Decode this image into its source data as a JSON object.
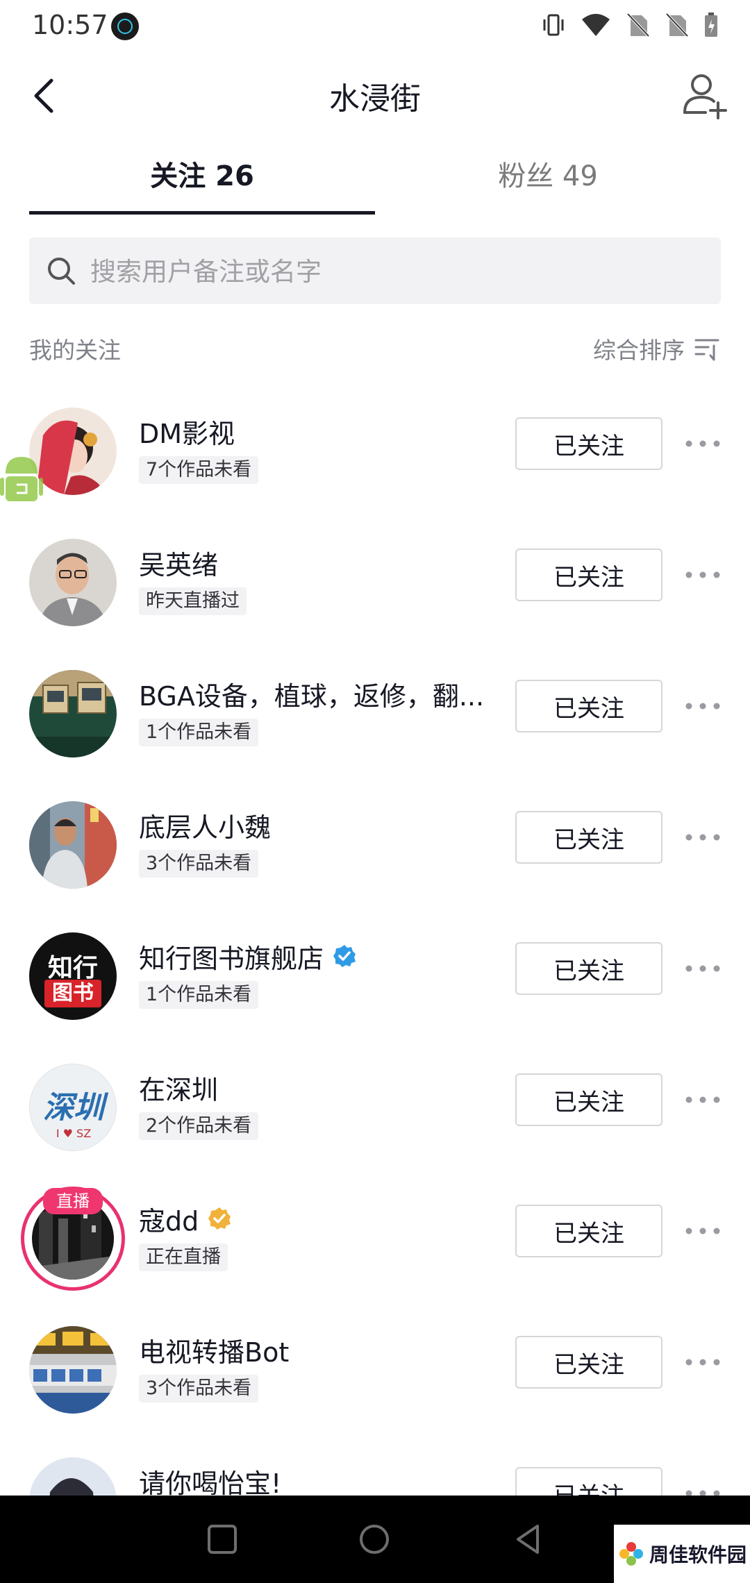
{
  "status_bar": {
    "time": "10:57"
  },
  "header": {
    "title": "水浸街"
  },
  "tabs": [
    {
      "label": "关注 26",
      "active": true
    },
    {
      "label": "粉丝 49",
      "active": false
    }
  ],
  "search": {
    "placeholder": "搜索用户备注或名字"
  },
  "section": {
    "title": "我的关注",
    "sort_label": "综合排序"
  },
  "follows": [
    {
      "name": "DM影视",
      "tag": "7个作品未看",
      "button": "已关注",
      "badge": ""
    },
    {
      "name": "吴英绪",
      "tag": "昨天直播过",
      "button": "已关注",
      "badge": ""
    },
    {
      "name": "BGA设备，植球，返修，翻...",
      "tag": "1个作品未看",
      "button": "已关注",
      "badge": ""
    },
    {
      "name": "底层人小魏",
      "tag": "3个作品未看",
      "button": "已关注",
      "badge": ""
    },
    {
      "name": "知行图书旗舰店",
      "tag": "1个作品未看",
      "button": "已关注",
      "badge": "blue-verified"
    },
    {
      "name": "在深圳",
      "tag": "2个作品未看",
      "button": "已关注",
      "badge": ""
    },
    {
      "name": "寇dd",
      "tag": "正在直播",
      "button": "已关注",
      "badge": "gold-verified",
      "live_label": "直播"
    },
    {
      "name": "电视转播Bot",
      "tag": "3个作品未看",
      "button": "已关注",
      "badge": ""
    },
    {
      "name": "请你喝怡宝!",
      "tag": "",
      "button": "已关注",
      "badge": ""
    }
  ],
  "avatar_text": {
    "zhixing_top": "知行",
    "zhixing_bottom": "图书",
    "shenzhen": "深圳",
    "shenzhen_sub": "I ♥ SZ"
  },
  "watermark": {
    "text": "周佳软件园"
  },
  "colors": {
    "accent_live": "#f0366f",
    "verified_blue": "#2f9be6",
    "verified_gold": "#f0b23a",
    "text_primary": "#161823"
  }
}
